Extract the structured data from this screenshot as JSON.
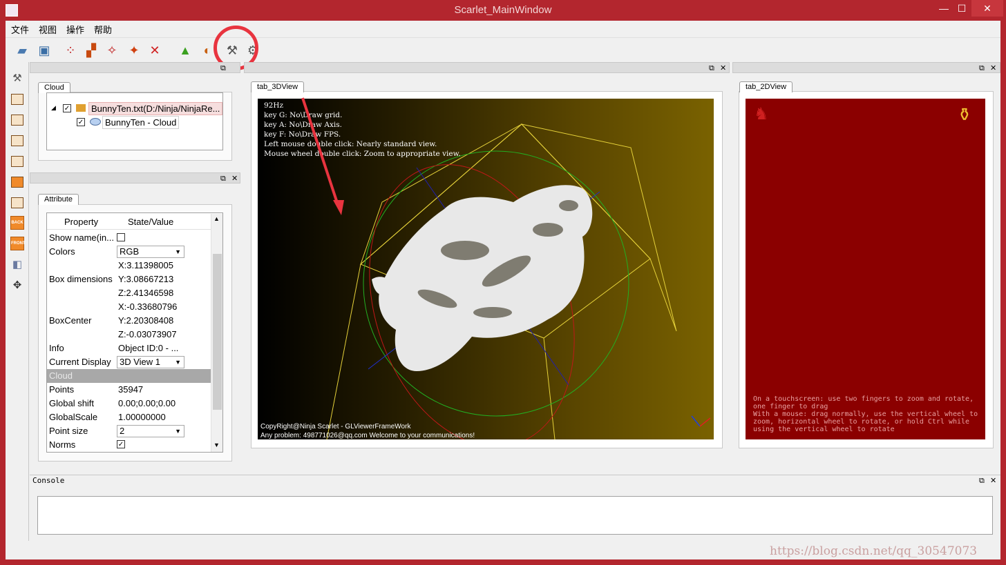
{
  "window": {
    "title": "Scarlet_MainWindow",
    "minimize": "—",
    "maximize": "☐",
    "close": "✕"
  },
  "menu": [
    "文件",
    "视图",
    "操作",
    "帮助"
  ],
  "docks": {
    "cloud_tab": "Cloud",
    "attribute_tab": "Attribute",
    "view3d_tab": "tab_3DView",
    "view2d_tab": "tab_2DView",
    "console_title": "Console"
  },
  "tree": {
    "root_label": "BunnyTen.txt(D:/Ninja/NinjaRe...",
    "child_label": "BunnyTen - Cloud"
  },
  "attributes": {
    "header_property": "Property",
    "header_value": "State/Value",
    "rows": [
      {
        "prop": "Show name(in...",
        "val": "",
        "type": "check",
        "checked": false
      },
      {
        "prop": "Colors",
        "val": "RGB",
        "type": "combo"
      },
      {
        "prop": "",
        "val": "X:3.11398005",
        "type": "text"
      },
      {
        "prop": "Box dimensions",
        "val": "Y:3.08667213",
        "type": "text"
      },
      {
        "prop": "",
        "val": "Z:2.41346598",
        "type": "text"
      },
      {
        "prop": "",
        "val": "X:-0.33680796",
        "type": "text"
      },
      {
        "prop": "BoxCenter",
        "val": "Y:2.20308408",
        "type": "text"
      },
      {
        "prop": "",
        "val": "Z:-0.03073907",
        "type": "text"
      },
      {
        "prop": "Info",
        "val": "Object ID:0 - ...",
        "type": "text"
      },
      {
        "prop": "Current Display",
        "val": "3D View 1",
        "type": "combo"
      },
      {
        "prop": "Cloud",
        "val": "",
        "type": "section"
      },
      {
        "prop": "Points",
        "val": "35947",
        "type": "text"
      },
      {
        "prop": "Global shift",
        "val": "0.00;0.00;0.00",
        "type": "text"
      },
      {
        "prop": "GlobalScale",
        "val": "1.00000000",
        "type": "text"
      },
      {
        "prop": "Point size",
        "val": "2",
        "type": "combo"
      },
      {
        "prop": "Norms",
        "val": "",
        "type": "check",
        "checked": true
      }
    ]
  },
  "view3d": {
    "fps": "92Hz",
    "help_lines": [
      "key G: No\\Draw grid.",
      "key A: No\\Draw Axis.",
      "key F: No\\Draw FPS.",
      "Left mouse double click: Nearly standard view.",
      "Mouse wheel double click: Zoom to appropriate view."
    ],
    "copyright": "CopyRight@Ninja Scarlet - GLViewerFrameWork",
    "contact": "Any problem: 498771026@qq.com Welcome to your communications!"
  },
  "view2d": {
    "help": "On a touchscreen: use two fingers to zoom and rotate, one finger to drag\nWith a mouse: drag normally, use the vertical wheel to zoom, horizontal wheel to rotate, or hold Ctrl while using the vertical wheel to rotate"
  },
  "left_toolbar_labels": [
    "BACK",
    "FRONT"
  ],
  "watermark": "https://blog.csdn.net/qq_30547073",
  "colors": {
    "frame": "#b3262e",
    "annotation": "#e8343f",
    "view2d_bg": "#8b0000"
  }
}
